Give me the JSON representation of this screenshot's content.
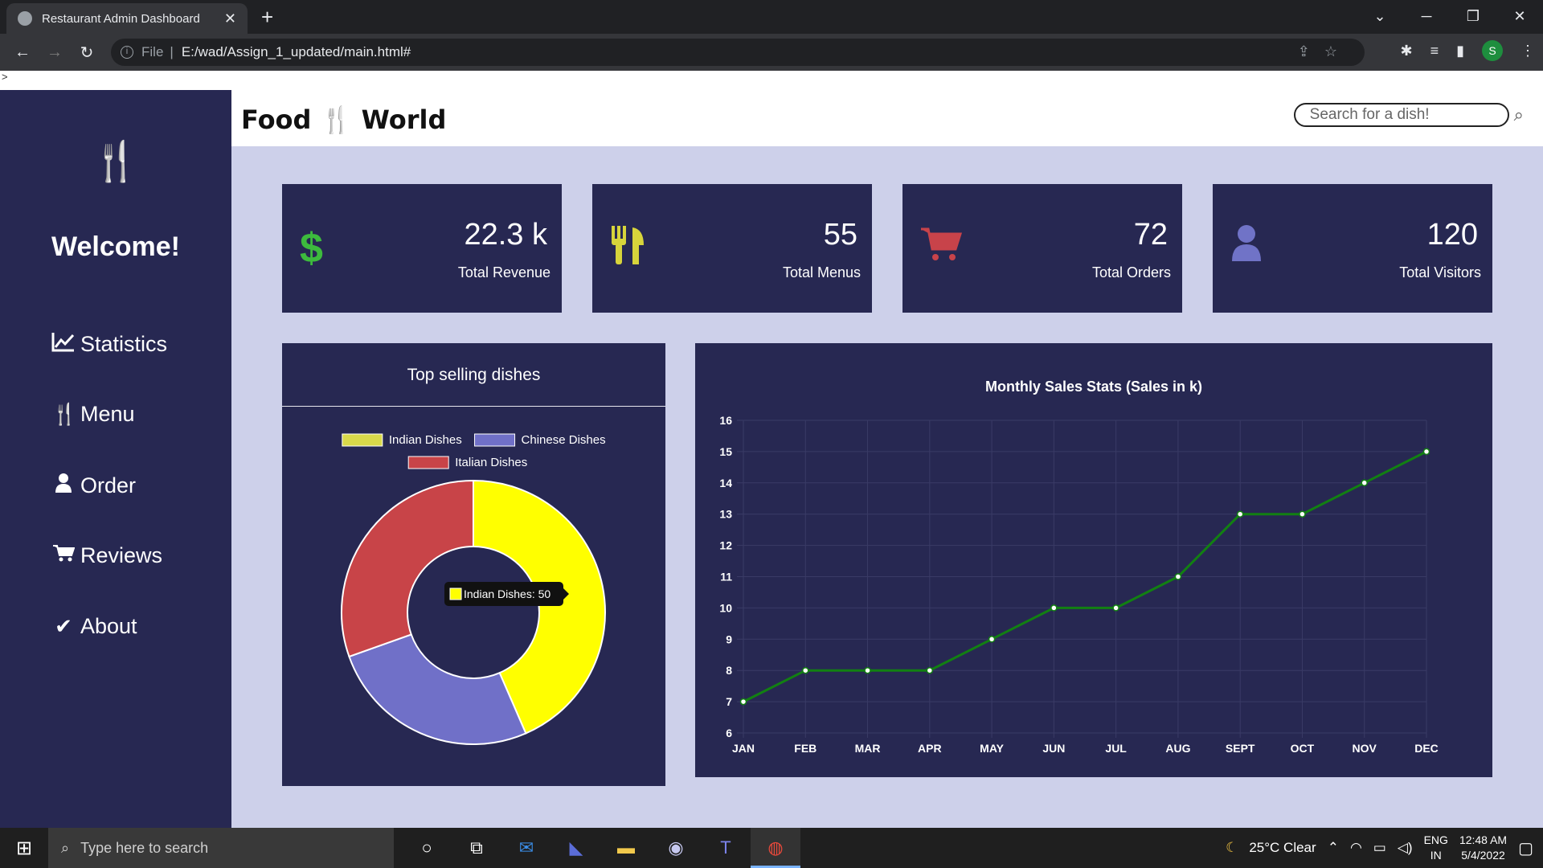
{
  "browser": {
    "tab_title": "Restaurant Admin Dashboard",
    "tab_close": "✕",
    "new_tab": "+",
    "url_scheme": "File",
    "url_path": "E:/wad/Assign_1_updated/main.html#",
    "profile_initial": "S"
  },
  "page_strip_text": ">",
  "sidebar": {
    "welcome": "Welcome!",
    "items": [
      {
        "label": "Statistics",
        "icon": "chart-line-icon"
      },
      {
        "label": "Menu",
        "icon": "utensils-icon"
      },
      {
        "label": "Order",
        "icon": "user-icon"
      },
      {
        "label": "Reviews",
        "icon": "cart-icon"
      },
      {
        "label": "About",
        "icon": "check-icon"
      }
    ]
  },
  "header": {
    "brand_left": "Food",
    "brand_right": "World",
    "search_placeholder": "Search for a dish!"
  },
  "cards": [
    {
      "value": "22.3 k",
      "label": "Total Revenue",
      "icon": "dollar-icon",
      "color": "#3dbb3d"
    },
    {
      "value": "55",
      "label": "Total Menus",
      "icon": "utensils-icon",
      "color": "#d7d43b"
    },
    {
      "value": "72",
      "label": "Total Orders",
      "icon": "cart-icon",
      "color": "#c8434a"
    },
    {
      "value": "120",
      "label": "Total Visitors",
      "icon": "user-icon",
      "color": "#7073c7"
    }
  ],
  "pie_panel": {
    "heading": "Top selling dishes",
    "tooltip": "Indian Dishes: 50"
  },
  "chart_data": [
    {
      "type": "pie",
      "variant": "doughnut",
      "title": "",
      "labels": [
        "Indian Dishes",
        "Chinese Dishes",
        "Italian Dishes"
      ],
      "values": [
        50,
        30,
        35
      ],
      "colors": [
        "#ffff00",
        "#7070c8",
        "#c84448"
      ],
      "legend_colors": [
        "#d9d94a",
        "#7070c8",
        "#c84448"
      ],
      "legend": "top"
    },
    {
      "type": "line",
      "title": "Monthly Sales Stats (Sales in k)",
      "categories": [
        "JAN",
        "FEB",
        "MAR",
        "APR",
        "MAY",
        "JUN",
        "JUL",
        "AUG",
        "SEPT",
        "OCT",
        "NOV",
        "DEC"
      ],
      "series": [
        {
          "values": [
            7,
            8,
            8,
            8,
            9,
            10,
            10,
            11,
            13,
            13,
            14,
            15
          ]
        }
      ],
      "ylim": [
        6,
        16
      ],
      "yticks": [
        6,
        7,
        8,
        9,
        10,
        11,
        12,
        13,
        14,
        15,
        16
      ],
      "grid": true,
      "line_color": "#128012"
    }
  ],
  "taskbar": {
    "search_placeholder": "Type here to search",
    "weather": "25°C  Clear",
    "lang_top": "ENG",
    "lang_bottom": "IN",
    "time": "12:48 AM",
    "date": "5/4/2022"
  },
  "colors": {
    "sidebar_bg": "#272852",
    "page_bg": "#cdd0ea",
    "card_bg": "#272852"
  }
}
